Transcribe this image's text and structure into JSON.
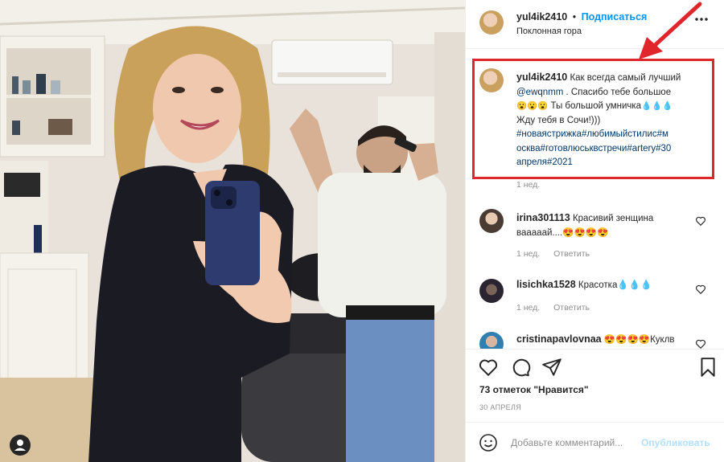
{
  "post": {
    "author": "yul4ik2410",
    "dot": "•",
    "follow_label": "Подписаться",
    "location": "Поклонная гора"
  },
  "caption": {
    "author": "yul4ik2410",
    "line1": "Как всегда самый лучший",
    "mention": "@ewqnmm",
    "line2": ". Спасибо тебе большое",
    "line3_emoji": "😮😮😮",
    "line3_text": "Ты большой умничка",
    "line3_drops": "💧💧💧",
    "line4": "Жду тебя в Сочи!)))",
    "hashtags_1": "#новаястрижка#любимыйстилис#м",
    "hashtags_2": "осква#готовлюськвстречи#artery#30",
    "hashtags_3": "апреля#2021",
    "time": "1 нед."
  },
  "comments": [
    {
      "author": "irina301113",
      "text": "Красивий зенщина вааааай....😍😍😍😍",
      "time": "1 нед.",
      "reply": "Ответить"
    },
    {
      "author": "lisichka1528",
      "text": "Красотка💧💧💧",
      "time": "1 нед.",
      "reply": "Ответить"
    },
    {
      "author": "cristinapavlovnaa",
      "text": "😍😍😍😍Куклв"
    }
  ],
  "likes": "73 отметок \"Нравится\"",
  "date": "30 АПРЕЛЯ",
  "composer": {
    "placeholder": "Добавьте комментарий...",
    "publish": "Опубликовать"
  },
  "colors": {
    "accent": "#0095f6",
    "hashtag": "#00376b",
    "highlight": "#e0262b"
  }
}
